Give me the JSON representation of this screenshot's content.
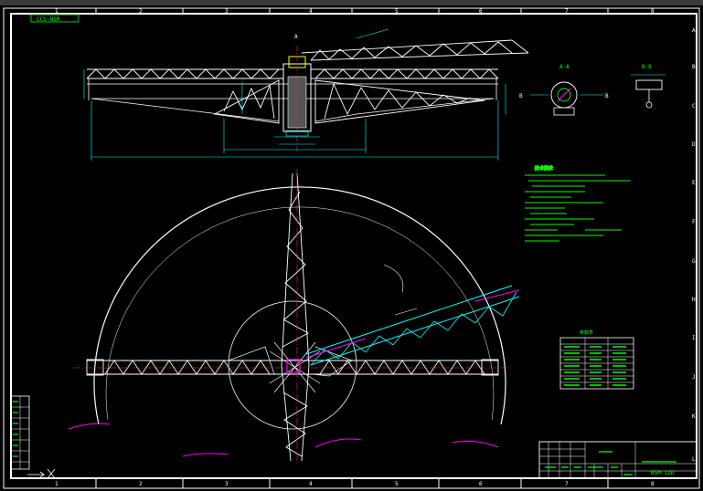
{
  "colors": {
    "background": "#000000",
    "frame": "#ffffff",
    "truss": "#ffffff",
    "cyan": "#00ffff",
    "green": "#00ff00",
    "yellow": "#ffff00",
    "magenta": "#ff00ff",
    "red": "#ff3030"
  },
  "drawing": {
    "code_tag": "CCS-NSM",
    "view_marker_a": "A",
    "section_label_aa": "A-A",
    "section_label_bb": "B-B",
    "section_mark_b": "B",
    "grid_top": [
      "1",
      "2",
      "3",
      "4",
      "5",
      "6",
      "7",
      "8"
    ],
    "grid_bottom": [
      "1",
      "2",
      "3",
      "4",
      "5",
      "6",
      "7",
      "8"
    ],
    "grid_right": [
      "A",
      "B",
      "C",
      "D",
      "E",
      "F",
      "G",
      "H",
      "I",
      "J",
      "K",
      "L"
    ],
    "bottom_right_code": "NSM-12D",
    "table_header": "参数表",
    "note_title": "技术要求"
  }
}
